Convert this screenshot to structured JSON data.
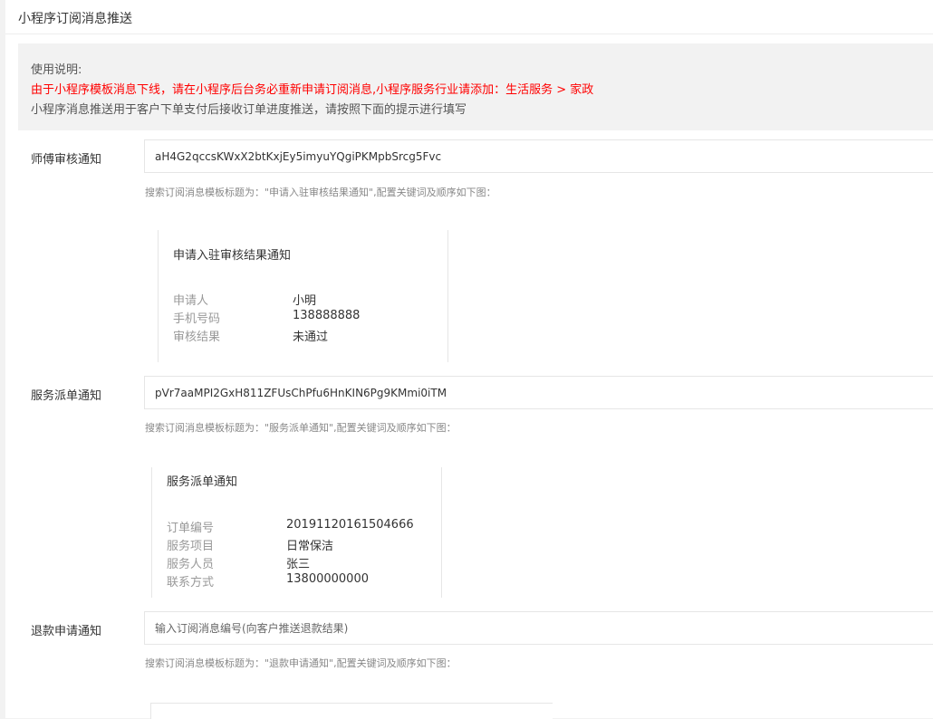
{
  "header": {
    "title": "小程序订阅消息推送"
  },
  "notice": {
    "line1": "使用说明:",
    "line2": "由于小程序模板消息下线，请在小程序后台务必重新申请订阅消息,小程序服务行业请添加：生活服务 > 家政",
    "line3": "小程序消息推送用于客户下单支付后接收订单进度推送，请按照下面的提示进行填写",
    "warning_color": "#ff0000"
  },
  "sections": [
    {
      "label": "师傅审核通知",
      "value": "aH4G2qccsKWxX2btKxjEy5imyuYQgiPKMpbSrcg5Fvc",
      "placeholder": "",
      "hint": "搜索订阅消息模板标题为：\"申请入驻审核结果通知\",配置关键词及顺序如下图：",
      "card": {
        "title": "申请入驻审核结果通知",
        "rows": [
          {
            "key": "申请人",
            "val": "小明"
          },
          {
            "key": "手机号码",
            "val": "138888888"
          },
          {
            "key": "审核结果",
            "val": "未通过"
          }
        ]
      }
    },
    {
      "label": "服务派单通知",
      "value": "pVr7aaMPI2GxH811ZFUsChPfu6HnKIN6Pg9KMmi0iTM",
      "placeholder": "",
      "hint": "搜索订阅消息模板标题为：\"服务派单通知\",配置关键词及顺序如下图：",
      "card": {
        "title": "服务派单通知",
        "rows": [
          {
            "key": "订单编号",
            "val": "20191120161504666"
          },
          {
            "key": "服务项目",
            "val": "日常保洁"
          },
          {
            "key": "服务人员",
            "val": "张三"
          },
          {
            "key": "联系方式",
            "val": "13800000000"
          }
        ]
      }
    },
    {
      "label": "退款申请通知",
      "value": "",
      "placeholder": "输入订阅消息编号(向客户推送退款结果)",
      "hint": "搜索订阅消息模板标题为：\"退款申请通知\",配置关键词及顺序如下图："
    }
  ]
}
